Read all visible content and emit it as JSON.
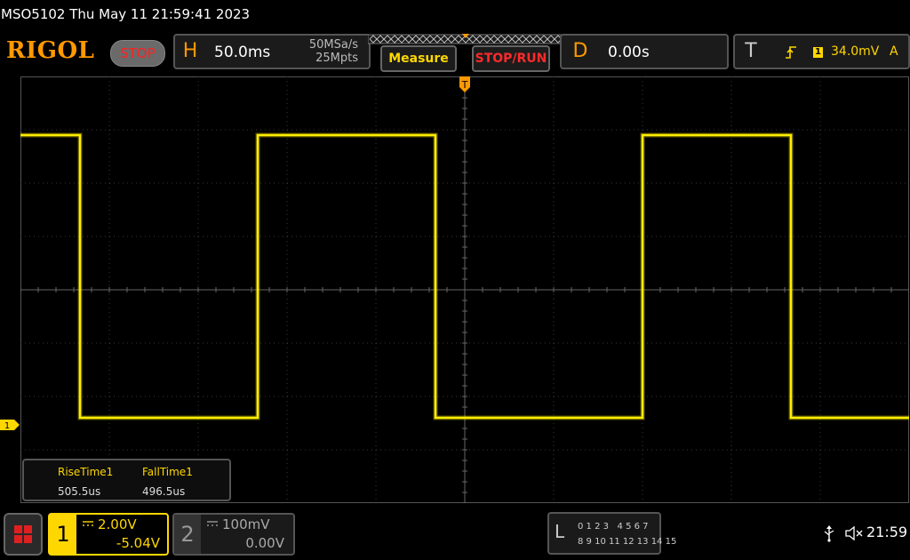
{
  "title": "MSO5102  Thu May 11 21:59:41 2023",
  "logo": "RIGOL",
  "run_state": "STOP",
  "horizontal": {
    "letter": "H",
    "timebase": "50.0ms",
    "sample_rate": "50MSa/s",
    "memory_depth": "25Mpts"
  },
  "buttons": {
    "measure": "Measure",
    "stop_run": "STOP/RUN"
  },
  "delay": {
    "letter": "D",
    "value": "0.00s"
  },
  "trigger": {
    "letter": "T",
    "source": "1",
    "level": "34.0mV",
    "mode": "A",
    "marker": "T"
  },
  "channel_marker": "1",
  "measurements": [
    {
      "label": "RiseTime1",
      "value": "505.5us"
    },
    {
      "label": "FallTime1",
      "value": "496.5us"
    }
  ],
  "channel1": {
    "number": "1",
    "scale": "2.00V",
    "offset": "-5.04V",
    "coupling": "DC"
  },
  "channel2": {
    "number": "2",
    "scale": "100mV",
    "offset": "0.00V",
    "coupling": "DC"
  },
  "logic": {
    "letter": "L",
    "row1": "0 1 2 3   4 5 6 7",
    "row2": "8 9 10 11 12 13 14 15"
  },
  "status": {
    "usb_icon": "usb-icon",
    "sound_icon": "speaker-muted-icon",
    "time": "21:59"
  },
  "colors": {
    "trace": "#ffee00",
    "accent": "#ff9900",
    "stop": "#ff2020",
    "grid": "#3a3a3a"
  },
  "waveform": {
    "type": "square",
    "high_div": 1.1,
    "low_div": 6.4,
    "transitions_div": [
      0.67,
      2.67,
      4.67,
      7.0,
      8.67
    ]
  }
}
